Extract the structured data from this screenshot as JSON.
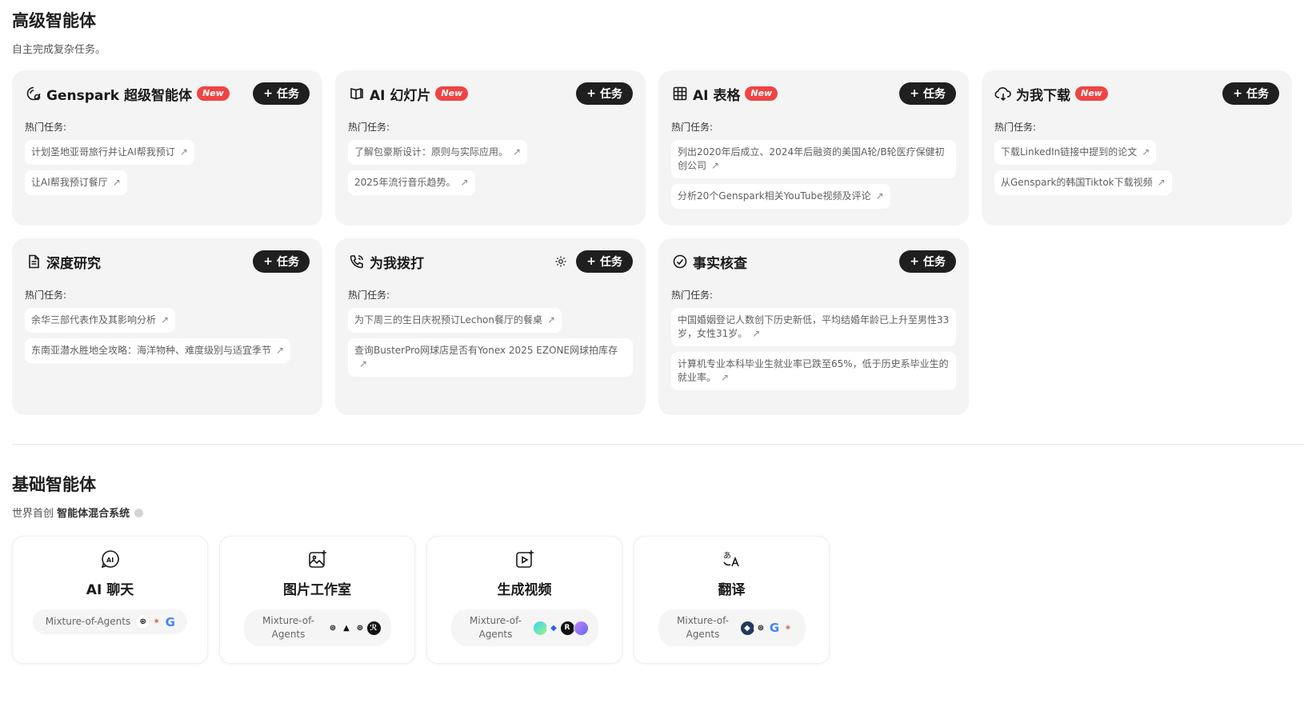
{
  "advanced": {
    "title": "高级智能体",
    "subtitle": "自主完成复杂任务。",
    "hot_label": "热门任务:",
    "task_button": "任务",
    "new_badge": "New",
    "cards": [
      {
        "title": "Genspark 超级智能体",
        "icon": "super-agent-icon",
        "is_new": true,
        "tasks": [
          "计划圣地亚哥旅行并让AI帮我预订",
          "让AI帮我预订餐厅"
        ]
      },
      {
        "title": "AI 幻灯片",
        "icon": "slides-icon",
        "is_new": true,
        "tasks": [
          "了解包豪斯设计：原则与实际应用。",
          "2025年流行音乐趋势。"
        ]
      },
      {
        "title": "AI 表格",
        "icon": "table-icon",
        "is_new": true,
        "tasks": [
          "列出2020年后成立、2024年后融资的美国A轮/B轮医疗保健初创公司",
          "分析20个Genspark相关YouTube视频及评论"
        ]
      },
      {
        "title": "为我下载",
        "icon": "cloud-download-icon",
        "is_new": true,
        "tasks": [
          "下载LinkedIn链接中提到的论文",
          "从Genspark的韩国Tiktok下载视频"
        ]
      },
      {
        "title": "深度研究",
        "icon": "document-icon",
        "is_new": false,
        "tasks": [
          "余华三部代表作及其影响分析",
          "东南亚潜水胜地全攻略：海洋物种、难度级别与适宜季节"
        ]
      },
      {
        "title": "为我拨打",
        "icon": "phone-call-icon",
        "is_new": false,
        "tasks": [
          "为下周三的生日庆祝预订Lechon餐厅的餐桌",
          "查询BusterPro网球店是否有Yonex 2025 EZONE网球拍库存"
        ]
      },
      {
        "title": "事实核查",
        "icon": "check-circle-icon",
        "is_new": false,
        "tasks": [
          "中国婚姻登记人数创下历史新低，平均结婚年龄已上升至男性33岁，女性31岁。",
          "计算机专业本科毕业生就业率已跌至65%，低于历史系毕业生的就业率。"
        ]
      }
    ]
  },
  "basic": {
    "title": "基础智能体",
    "subtitle_prefix": "世界首创",
    "subtitle_bold": "智能体混合系统",
    "moa_label": "Mixture-of-Agents",
    "moa_label_wrapped": "Mixture-of-Agents",
    "cards": [
      {
        "title": "AI 聊天",
        "icon": "ai-chat-icon",
        "logos": [
          "openai",
          "claude",
          "google"
        ]
      },
      {
        "title": "图片工作室",
        "icon": "image-studio-icon",
        "logos": [
          "openai",
          "midjourney",
          "stability",
          "flux"
        ]
      },
      {
        "title": "生成视频",
        "icon": "video-icon",
        "logos": [
          "kling",
          "pixverse",
          "runway",
          "luma"
        ]
      },
      {
        "title": "翻译",
        "icon": "translate-icon",
        "logos": [
          "deepseek",
          "openai",
          "google",
          "claude"
        ]
      }
    ]
  }
}
